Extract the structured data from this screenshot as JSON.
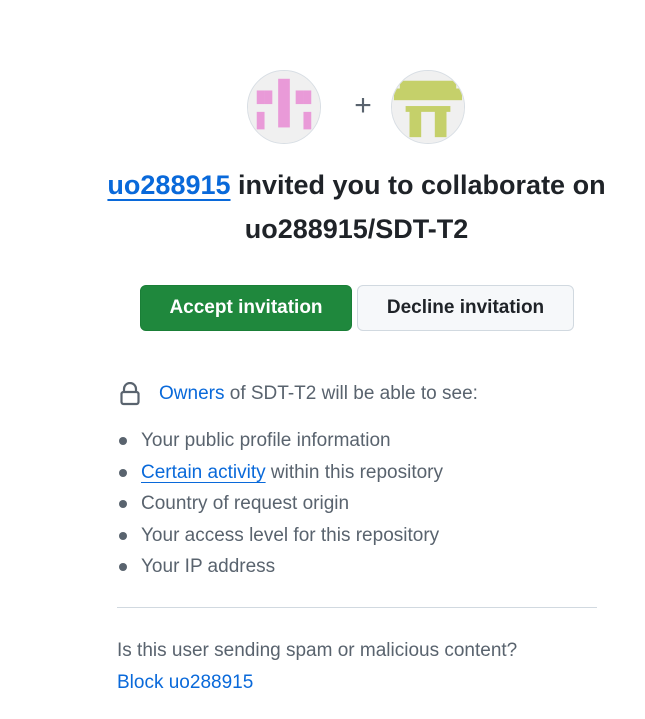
{
  "header": {
    "inviter": "uo288915",
    "invite_text": "invited you to collaborate on",
    "repository": "uo288915/SDT-T2"
  },
  "avatars": {
    "plus_sign": "+",
    "inviter_color": "#e99ad8",
    "invitee_color": "#c5d06a"
  },
  "actions": {
    "accept_label": "Accept invitation",
    "decline_label": "Decline invitation"
  },
  "visibility": {
    "owners_link": "Owners",
    "owners_text": "of SDT-T2 will be able to see:",
    "items": [
      {
        "text": "Your public profile information"
      },
      {
        "link": "Certain activity",
        "text": "within this repository"
      },
      {
        "text": "Country of request origin"
      },
      {
        "text": "Your access level for this repository"
      },
      {
        "text": "Your IP address"
      }
    ]
  },
  "spam": {
    "question": "Is this user sending spam or malicious content?",
    "block_link": "Block uo288915"
  },
  "colors": {
    "accent": "#0969da",
    "accept_bg": "#1f883d",
    "muted_text": "#59636e"
  },
  "icons": {
    "lock": "lock-icon"
  }
}
